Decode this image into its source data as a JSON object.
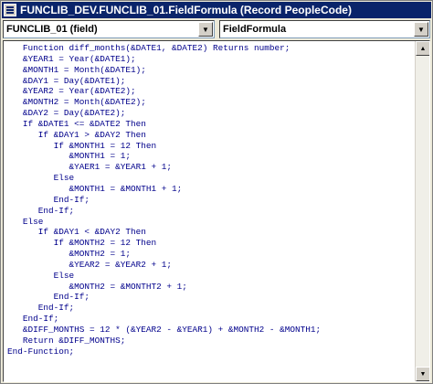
{
  "window": {
    "title": "FUNCLIB_DEV.FUNCLIB_01.FieldFormula (Record PeopleCode)"
  },
  "toolbar": {
    "object_select": "FUNCLIB_01   (field)",
    "event_select": "FieldFormula"
  },
  "colors": {
    "title_bar": "#0a246a",
    "code_text": "#00008b",
    "window_bg": "#ece9d8"
  },
  "icons": {
    "app": "peoplecode-window-icon",
    "dropdown": "chevron-down-icon",
    "scroll_up": "scroll-up-icon",
    "scroll_down": "scroll-down-icon"
  },
  "code_lines": [
    "   Function diff_months(&DATE1, &DATE2) Returns number;",
    "   &YEAR1 = Year(&DATE1);",
    "   &MONTH1 = Month(&DATE1);",
    "   &DAY1 = Day(&DATE1);",
    "   &YEAR2 = Year(&DATE2);",
    "   &MONTH2 = Month(&DATE2);",
    "   &DAY2 = Day(&DATE2);",
    "   If &DATE1 <= &DATE2 Then",
    "      If &DAY1 > &DAY2 Then",
    "         If &MONTH1 = 12 Then",
    "            &MONTH1 = 1;",
    "            &YAER1 = &YEAR1 + 1;",
    "         Else",
    "            &MONTH1 = &MONTH1 + 1;",
    "         End-If;",
    "      End-If;",
    "   Else",
    "      If &DAY1 < &DAY2 Then",
    "         If &MONTH2 = 12 Then",
    "            &MONTH2 = 1;",
    "            &YEAR2 = &YEAR2 + 1;",
    "         Else",
    "            &MONTH2 = &MONTHT2 + 1;",
    "         End-If;",
    "      End-If;",
    "   End-If;",
    "   &DIFF_MONTHS = 12 * (&YEAR2 - &YEAR1) + &MONTH2 - &MONTH1;",
    "   Return &DIFF_MONTHS;",
    "End-Function;"
  ]
}
